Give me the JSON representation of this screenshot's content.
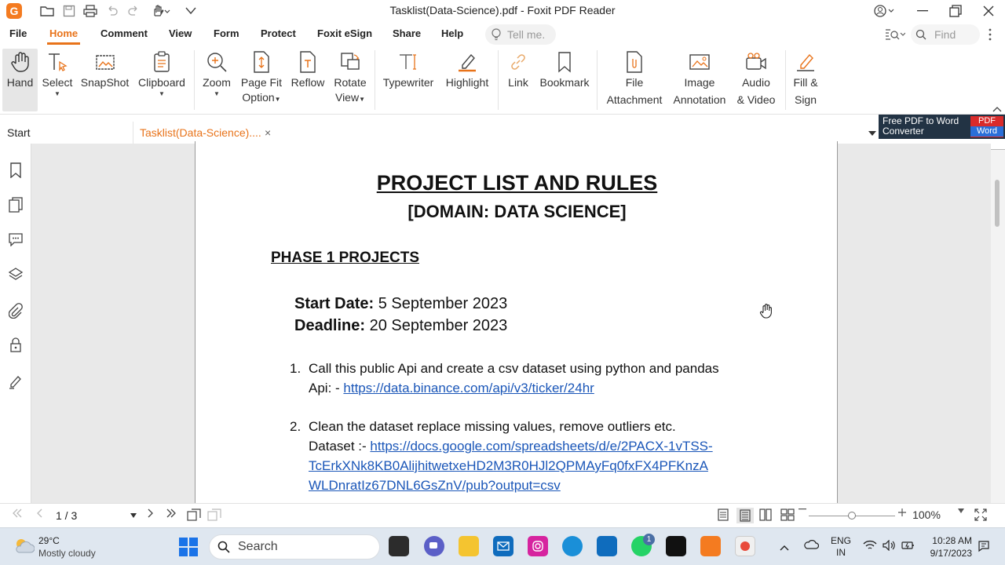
{
  "window": {
    "title": "Tasklist(Data-Science).pdf - Foxit PDF Reader",
    "app_logo_letter": "G"
  },
  "menu": {
    "items": [
      "File",
      "Home",
      "Comment",
      "View",
      "Form",
      "Protect",
      "Foxit eSign",
      "Share",
      "Help"
    ],
    "active": "Home",
    "tell_me_placeholder": "Tell me.",
    "find_placeholder": "Find"
  },
  "ribbon": {
    "hand": "Hand",
    "select": "Select",
    "snapshot": "SnapShot",
    "clipboard": "Clipboard",
    "zoom": "Zoom",
    "page_fit_1": "Page Fit",
    "page_fit_2": "Option",
    "reflow": "Reflow",
    "rotate_1": "Rotate",
    "rotate_2": "View",
    "typewriter": "Typewriter",
    "highlight": "Highlight",
    "link": "Link",
    "bookmark": "Bookmark",
    "file_att_1": "File",
    "file_att_2": "Attachment",
    "image_ann_1": "Image",
    "image_ann_2": "Annotation",
    "audio_1": "Audio",
    "audio_2": "& Video",
    "fill_1": "Fill &",
    "fill_2": "Sign"
  },
  "tabs": {
    "start": "Start",
    "document": "Tasklist(Data-Science)....",
    "close_glyph": "×"
  },
  "ad": {
    "line1": "Free PDF to Word",
    "line2": "Converter",
    "badge_top": "PDF",
    "badge_bottom": "Word"
  },
  "document": {
    "title": "PROJECT LIST AND RULES",
    "subtitle": "[DOMAIN: DATA SCIENCE]",
    "phase_heading": "PHASE 1 PROJECTS",
    "start_label": "Start Date:",
    "start_value": " 5 September 2023",
    "deadline_label": "Deadline:",
    "deadline_value": " 20 September 2023",
    "items": [
      {
        "num": "1.",
        "text": "Call this public Api and create a csv dataset using python and pandas",
        "link_prefix": "Api: - ",
        "link": "https://data.binance.com/api/v3/ticker/24hr"
      },
      {
        "num": "2.",
        "text": "Clean the dataset replace missing values, remove outliers etc.",
        "link_prefix": "Dataset :- ",
        "link_line1": "https://docs.google.com/spreadsheets/d/e/2PACX-1vTSS-",
        "link_line2": "TcErkXNk8KB0AlijhitwetxeHD2M3R0HJl2QPMAyFq0fxFX4PFKnzA",
        "link_line3": "WLDnratIz67DNL6GsZnV/pub?output=csv"
      }
    ]
  },
  "status": {
    "page_field": "1 / 3",
    "zoom": "100%",
    "zoom_slider_fraction": 0.5
  },
  "taskbar": {
    "temperature": "29°C",
    "weather": "Mostly cloudy",
    "search_placeholder": "Search",
    "notif_badge": "1",
    "lang_1": "ENG",
    "lang_2": "IN",
    "time": "10:28 AM",
    "date": "9/17/2023"
  },
  "colors": {
    "accent": "#e8731a",
    "link": "#1a56b8",
    "taskbar_bg": "#dfe7f0"
  }
}
